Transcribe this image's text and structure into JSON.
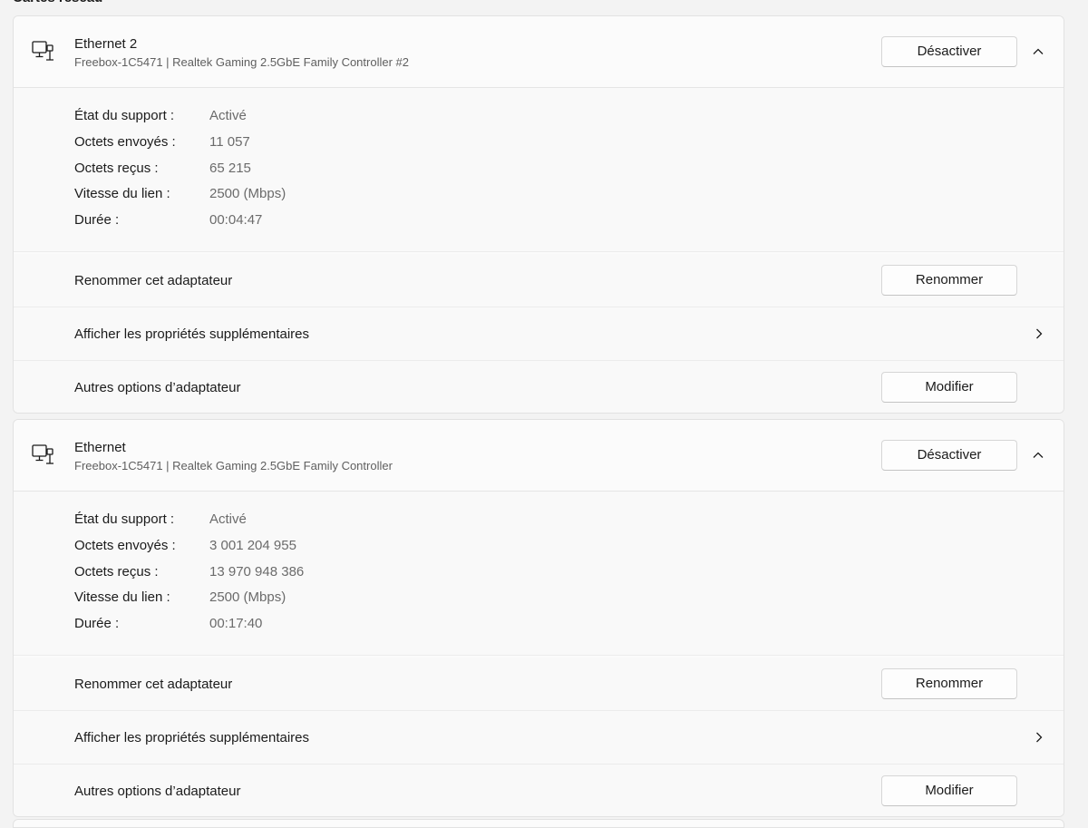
{
  "section": {
    "title": "Cartes réseau"
  },
  "adapters": [
    {
      "name": "Ethernet 2",
      "description": "Freebox-1C5471 | Realtek Gaming 2.5GbE Family Controller #2",
      "disable_label": "Désactiver",
      "icon": "ethernet-computer-icon",
      "details": [
        {
          "label": "État du support :",
          "value": "Activé"
        },
        {
          "label": "Octets envoyés :",
          "value": "11 057"
        },
        {
          "label": "Octets reçus :",
          "value": "65 215"
        },
        {
          "label": "Vitesse du lien :",
          "value": "2500 (Mbps)"
        },
        {
          "label": "Durée :",
          "value": "00:04:47"
        }
      ],
      "rename": {
        "label": "Renommer cet adaptateur",
        "button": "Renommer"
      },
      "properties": {
        "label": "Afficher les propriétés supplémentaires"
      },
      "more_options": {
        "label": "Autres options d’adaptateur",
        "button": "Modifier"
      }
    },
    {
      "name": "Ethernet",
      "description": "Freebox-1C5471 | Realtek Gaming 2.5GbE Family Controller",
      "disable_label": "Désactiver",
      "icon": "ethernet-computer-icon",
      "details": [
        {
          "label": "État du support :",
          "value": "Activé"
        },
        {
          "label": "Octets envoyés :",
          "value": "3 001 204 955"
        },
        {
          "label": "Octets reçus :",
          "value": "13 970 948 386"
        },
        {
          "label": "Vitesse du lien :",
          "value": "2500 (Mbps)"
        },
        {
          "label": "Durée :",
          "value": "00:17:40"
        }
      ],
      "rename": {
        "label": "Renommer cet adaptateur",
        "button": "Renommer"
      },
      "properties": {
        "label": "Afficher les propriétés supplémentaires"
      },
      "more_options": {
        "label": "Autres options d’adaptateur",
        "button": "Modifier"
      }
    }
  ]
}
